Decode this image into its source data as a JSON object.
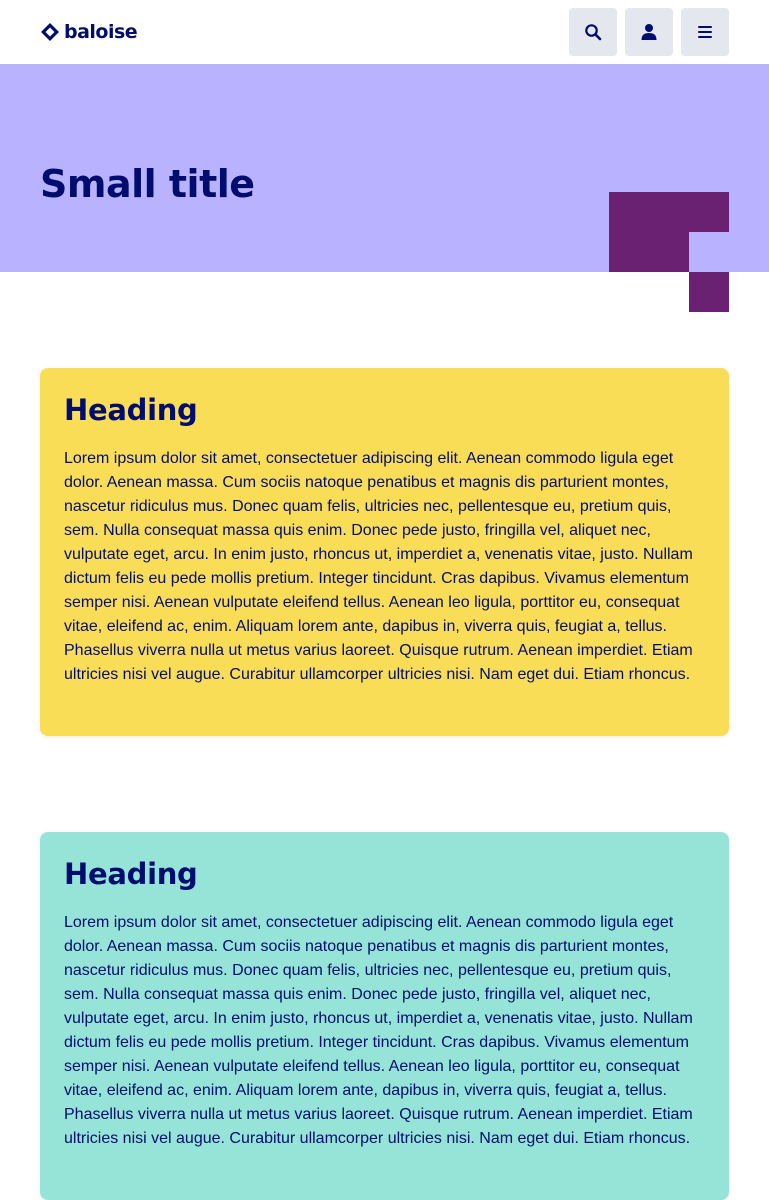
{
  "header": {
    "logo_text": "baloise",
    "search_icon": "search-icon",
    "user_icon": "user-icon",
    "menu_icon": "hamburger-menu-icon"
  },
  "hero": {
    "title": "Small title",
    "background": "#b8b2ff",
    "accent": "#6b2171"
  },
  "cards": [
    {
      "heading": "Heading",
      "background": "#fadd56",
      "body": "Lorem ipsum dolor sit amet, consectetuer adipiscing elit. Aenean commodo ligula eget dolor. Aenean massa. Cum sociis natoque penatibus et magnis dis parturient montes, nascetur ridiculus mus. Donec quam felis, ultricies nec, pellentesque eu, pretium quis, sem. Nulla consequat massa quis enim. Donec pede justo, fringilla vel, aliquet nec, vulputate eget, arcu. In enim justo, rhoncus ut, imperdiet a, venenatis vitae, justo. Nullam dictum felis eu pede mollis pretium. Integer tincidunt. Cras dapibus. Vivamus elementum semper nisi. Aenean vulputate eleifend tellus. Aenean leo ligula, porttitor eu, consequat vitae, eleifend ac, enim. Aliquam lorem ante, dapibus in, viverra quis, feugiat a, tellus. Phasellus viverra nulla ut metus varius laoreet. Quisque rutrum. Aenean imperdiet. Etiam ultricies nisi vel augue. Curabitur ullamcorper ultricies nisi. Nam eget dui. Etiam rhoncus."
    },
    {
      "heading": "Heading",
      "background": "#96e3d8",
      "body": "Lorem ipsum dolor sit amet, consectetuer adipiscing elit. Aenean commodo ligula eget dolor. Aenean massa. Cum sociis natoque penatibus et magnis dis parturient montes, nascetur ridiculus mus. Donec quam felis, ultricies nec, pellentesque eu, pretium quis, sem. Nulla consequat massa quis enim. Donec pede justo, fringilla vel, aliquet nec, vulputate eget, arcu. In enim justo, rhoncus ut, imperdiet a, venenatis vitae, justo. Nullam dictum felis eu pede mollis pretium. Integer tincidunt. Cras dapibus. Vivamus elementum semper nisi. Aenean vulputate eleifend tellus. Aenean leo ligula, porttitor eu, consequat vitae, eleifend ac, enim. Aliquam lorem ante, dapibus in, viverra quis, feugiat a, tellus. Phasellus viverra nulla ut metus varius laoreet. Quisque rutrum. Aenean imperdiet. Etiam ultricies nisi vel augue. Curabitur ullamcorper ultricies nisi. Nam eget dui. Etiam rhoncus."
    }
  ]
}
